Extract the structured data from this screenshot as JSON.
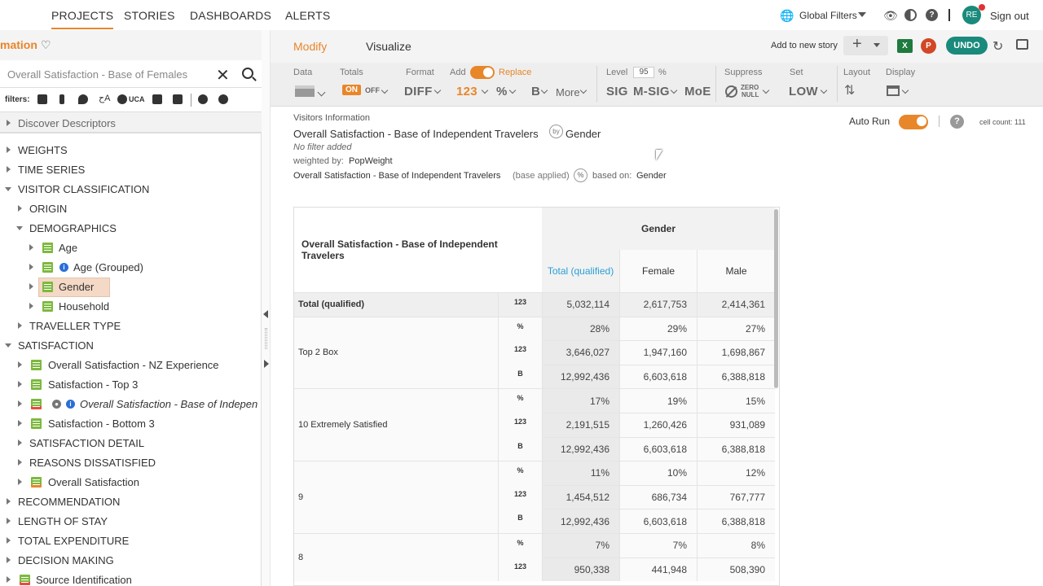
{
  "nav": {
    "items": [
      "PROJECTS",
      "STORIES",
      "DASHBOARDS",
      "ALERTS"
    ],
    "global_filters": "Global Filters",
    "avatar": "RE",
    "sign_out": "Sign out"
  },
  "left": {
    "title": "mation",
    "search_value": "Overall Satisfaction - Base of Females",
    "filters_label": "filters:",
    "uca": "UCA",
    "discover": "Discover Descriptors",
    "tree": [
      {
        "label": "WEIGHTS"
      },
      {
        "label": "TIME SERIES"
      },
      {
        "label": "VISITOR CLASSIFICATION"
      },
      {
        "label": "ORIGIN"
      },
      {
        "label": "DEMOGRAPHICS"
      },
      {
        "label": "Age"
      },
      {
        "label": "Age (Grouped)"
      },
      {
        "label": "Gender"
      },
      {
        "label": "Household"
      },
      {
        "label": "TRAVELLER TYPE"
      },
      {
        "label": "SATISFACTION"
      },
      {
        "label": "Overall Satisfaction - NZ Experience"
      },
      {
        "label": "Satisfaction - Top 3"
      },
      {
        "label": "Overall Satisfaction - Base of Indepen"
      },
      {
        "label": "Satisfaction - Bottom 3"
      },
      {
        "label": "SATISFACTION DETAIL"
      },
      {
        "label": "REASONS DISSATISFIED"
      },
      {
        "label": "Overall Satisfaction"
      },
      {
        "label": "RECOMMENDATION"
      },
      {
        "label": "LENGTH OF STAY"
      },
      {
        "label": "TOTAL EXPENDITURE"
      },
      {
        "label": "DECISION MAKING"
      },
      {
        "label": "Source Identification"
      }
    ]
  },
  "tabs": {
    "modify": "Modify",
    "visualize": "Visualize",
    "add_story": "Add to new story",
    "undo": "UNDO"
  },
  "toolbar": {
    "data": "Data",
    "totals": "Totals",
    "on": "ON",
    "off": "OFF",
    "format": "Format",
    "diff": "DIFF",
    "add": "Add",
    "replace": "Replace",
    "n123": "123",
    "pct": "%",
    "b": "B",
    "more": "More",
    "level": "Level",
    "level_val": "95",
    "level_unit": "%",
    "sig": "SIG",
    "msig": "M-SIG",
    "moe": "MoE",
    "suppress": "Suppress",
    "zero": "ZERO",
    "null": "NULL",
    "set": "Set",
    "low": "LOW",
    "layout": "Layout",
    "display": "Display"
  },
  "info": {
    "section": "Visitors Information",
    "title_left": "Overall Satisfaction - Base of Independent Travelers",
    "by": "by",
    "title_right": "Gender",
    "filter": "No filter added",
    "weighted_prefix": "weighted by:",
    "weighted_value": "PopWeight",
    "base_var": "Overall Satisfaction - Base of Independent Travelers",
    "base_applied": "(base applied)",
    "based_on_prefix": "based on:",
    "based_on": "Gender",
    "auto_run": "Auto Run",
    "cell_count": "cell count: 111"
  },
  "table": {
    "row_header": "Overall Satisfaction - Base of Independent Travelers",
    "col_group": "Gender",
    "columns": [
      "Total (qualified)",
      "Female",
      "Male"
    ],
    "rows": [
      {
        "label": "Total (qualified)",
        "stats": [
          {
            "type": "123",
            "values": [
              "5,032,114",
              "2,617,753",
              "2,414,361"
            ]
          }
        ]
      },
      {
        "label": "Top 2 Box",
        "stats": [
          {
            "type": "%",
            "values": [
              "28%",
              "29%",
              "27%"
            ]
          },
          {
            "type": "123",
            "values": [
              "3,646,027",
              "1,947,160",
              "1,698,867"
            ]
          },
          {
            "type": "B",
            "values": [
              "12,992,436",
              "6,603,618",
              "6,388,818"
            ]
          }
        ]
      },
      {
        "label": "10 Extremely Satisfied",
        "stats": [
          {
            "type": "%",
            "values": [
              "17%",
              "19%",
              "15%"
            ]
          },
          {
            "type": "123",
            "values": [
              "2,191,515",
              "1,260,426",
              "931,089"
            ]
          },
          {
            "type": "B",
            "values": [
              "12,992,436",
              "6,603,618",
              "6,388,818"
            ]
          }
        ]
      },
      {
        "label": "9",
        "stats": [
          {
            "type": "%",
            "values": [
              "11%",
              "10%",
              "12%"
            ]
          },
          {
            "type": "123",
            "values": [
              "1,454,512",
              "686,734",
              "767,777"
            ]
          },
          {
            "type": "B",
            "values": [
              "12,992,436",
              "6,603,618",
              "6,388,818"
            ]
          }
        ]
      },
      {
        "label": "8",
        "stats": [
          {
            "type": "%",
            "values": [
              "7%",
              "7%",
              "8%"
            ]
          },
          {
            "type": "123",
            "values": [
              "950,338",
              "441,948",
              "508,390"
            ]
          }
        ]
      }
    ]
  },
  "colors": {
    "accent": "#e8862a",
    "teal": "#1a8a7c",
    "link": "#2a9fd6"
  }
}
